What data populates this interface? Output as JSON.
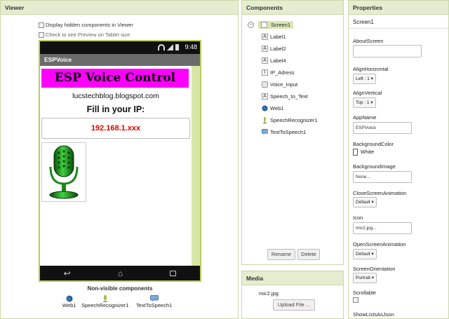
{
  "viewer": {
    "title": "Viewer",
    "hidden_checkbox_label": "Display hidden components in Viewer",
    "tablet_checkbox_label": "Check to see Preview on Tablet size",
    "phone": {
      "time": "9:48",
      "app_title": "ESPVoice",
      "banner_text": "ESP Voice Control",
      "blog_text": "lucstechblog.blogspot.com",
      "prompt_text": "Fill in your IP:",
      "ip_value": "192.168.1.xxx"
    },
    "nonvisible_title": "Non-visible components",
    "nonvisible": [
      "Web1",
      "SpeechRecognizer1",
      "TextToSpeech1"
    ]
  },
  "components": {
    "title": "Components",
    "tree": [
      {
        "label": "Screen1",
        "icon": "screen-icon"
      },
      {
        "label": "Label1",
        "icon": "label-icon"
      },
      {
        "label": "Label2",
        "icon": "label-icon"
      },
      {
        "label": "Label4",
        "icon": "label-icon"
      },
      {
        "label": "IP_Adress",
        "icon": "textbox-icon"
      },
      {
        "label": "Voice_Input",
        "icon": "button-icon"
      },
      {
        "label": "Speech_to_Text",
        "icon": "label-icon"
      },
      {
        "label": "Web1",
        "icon": "globe-icon"
      },
      {
        "label": "SpeechRecognizer1",
        "icon": "microphone-icon"
      },
      {
        "label": "TextToSpeech1",
        "icon": "speech-bubble-icon"
      }
    ],
    "rename_label": "Rename",
    "delete_label": "Delete"
  },
  "media": {
    "title": "Media",
    "file": "mic2.jpg",
    "upload_label": "Upload File ..."
  },
  "properties": {
    "title": "Properties",
    "component": "Screen1",
    "about_screen_label": "AboutScreen",
    "align_h_label": "AlignHorizontal",
    "align_h_value": "Left : 1 ▾",
    "align_v_label": "AlignVertical",
    "align_v_value": "Top : 1 ▾",
    "app_name_label": "AppName",
    "app_name_value": "ESPVoice",
    "bg_color_label": "BackgroundColor",
    "bg_color_value": "White",
    "bg_image_label": "BackgroundImage",
    "bg_image_value": "None...",
    "close_anim_label": "CloseScreenAnimation",
    "close_anim_value": "Default ▾",
    "icon_label": "Icon",
    "icon_value": "mic2.jpg...",
    "open_anim_label": "OpenScreenAnimation",
    "open_anim_value": "Default ▾",
    "orientation_label": "ScreenOrientation",
    "orientation_value": "Portrait ▾",
    "scrollable_label": "Scrollable",
    "show_lists_label": "ShowListsAsJson"
  },
  "colors": {
    "panel_header": "#e4edcf",
    "phone_border": "#b5cf5a",
    "banner": "#ff00ff",
    "ip_text": "#e00000"
  }
}
